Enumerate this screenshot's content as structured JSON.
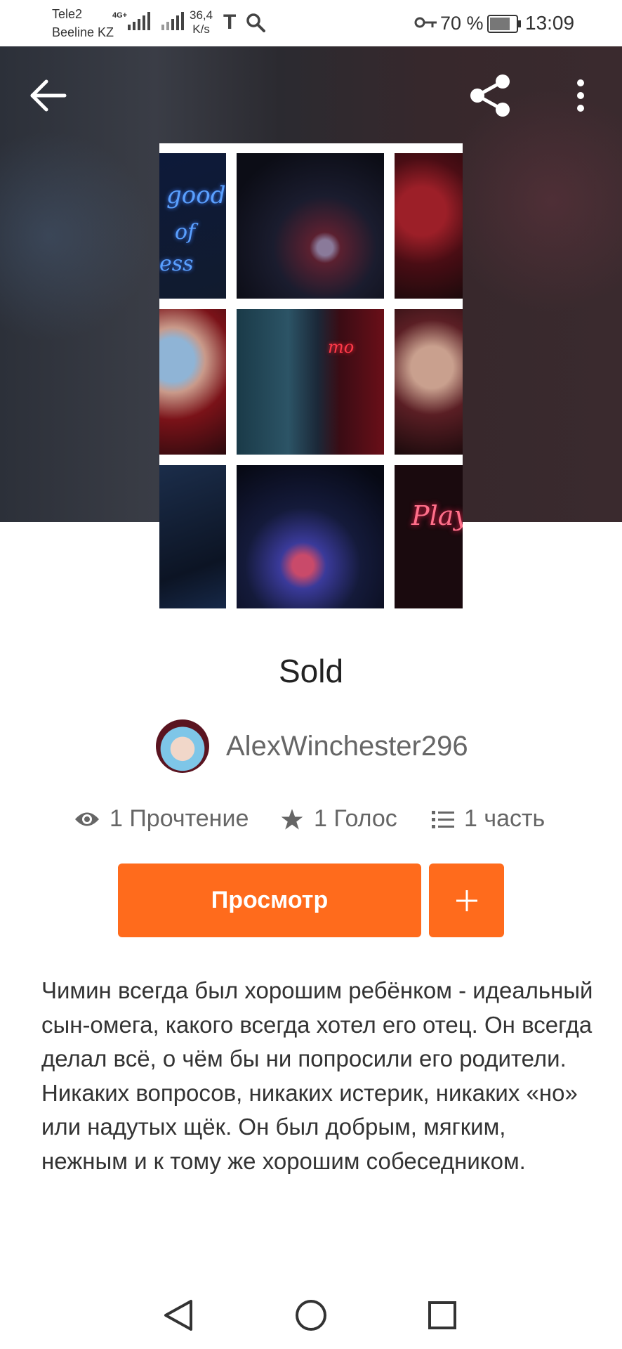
{
  "status_bar": {
    "carrier_1": "Tele2",
    "carrier_2": "Beeline KZ",
    "network_type": "4G+",
    "speed_value": "36,4",
    "speed_unit": "K/s",
    "battery": "70 %",
    "battery_level": 0.7,
    "time": "13:09"
  },
  "story": {
    "title": "Sold",
    "author": "AlexWinchester296",
    "stats": {
      "reads": "1 Прочтение",
      "votes": "1 Голос",
      "parts": "1 часть"
    },
    "view_button": "Просмотр",
    "description": "Чимин всегда был хорошим ребёнком - идеальный сын-омега, какого всегда хотел его отец. Он всегда делал всё, о чём бы ни попросили его родители. Никаких вопросов, никаких истерик, никаких «но» или надутых щёк. Он был добрым, мягким, нежным и к тому же хорошим собеседником."
  },
  "colors": {
    "accent": "#ff6b1c"
  }
}
